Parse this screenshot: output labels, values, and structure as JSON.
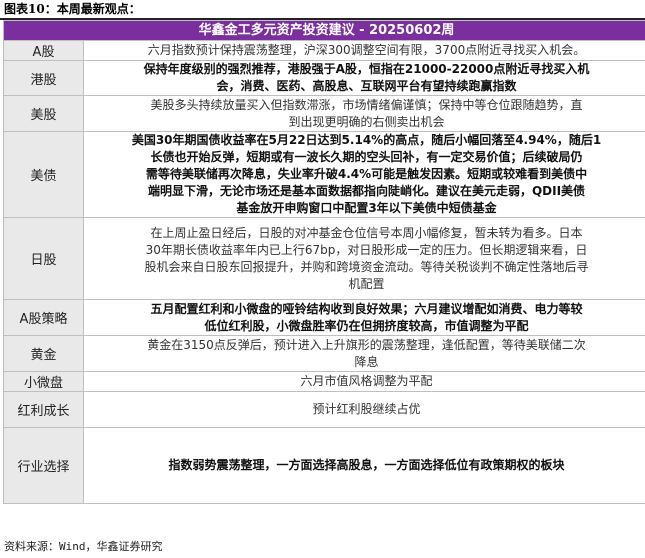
{
  "figure_title": "图表10：本周最新观点：",
  "table_header": "华鑫金工多元资产投资建议 - 20250602周",
  "rows": [
    {
      "label": "A股",
      "style": "normal",
      "lines": [
        "六月指数预计保持震荡整理，沪深300调整空间有限，3700点附近寻找买入机会。"
      ]
    },
    {
      "label": "港股",
      "style": "bold",
      "lines": [
        "保持年度级别的强烈推荐，港股强于A股，恒指在21000-22000点附近寻找买入机",
        "会，消费、医药、高股息、互联网平台有望持续跑赢指数"
      ]
    },
    {
      "label": "美股",
      "style": "normal",
      "lines": [
        "美股多头持续放量买入但指数滞涨，市场情绪偏谨慎；保持中等仓位跟随趋势，直",
        "到出现更明确的右侧卖出机会"
      ]
    },
    {
      "label": "美债",
      "style": "bold",
      "lines": [
        "美国30年期国债收益率在5月22日达到5.14%的高点，随后小幅回落至4.94%，随后1",
        "长债也开始反弹，短期或有一波长久期的空头回补，有一定交易价值；后续破局仍",
        "需等待美联储再次降息，失业率升破4.4%可能是触发因素。短期或较难看到美债中",
        "端明显下滑，无论市场还是基本面数据都指向陡峭化。建议在美元走弱，QDII美债",
        "基金放开申购窗口中配置3年以下美债中短债基金"
      ]
    },
    {
      "label": "日股",
      "style": "normal",
      "lines": [
        "在上周止盈日经后，日股的对冲基金仓位信号本周小幅修复，暂未转为看多。日本",
        "30年期长债收益率年内已上行67bp，对日股形成一定的压力。但长期逻辑来看，日",
        "股机会来自日股东回报提升，并购和跨境资金流动。等待关税谈判不确定性落地后寻",
        "机配置"
      ]
    },
    {
      "label": "A股策略",
      "style": "bold",
      "lines": [
        "五月配置红利和小微盘的哑铃结构收到良好效果；六月建议增配如消费、电力等较",
        "低位红利股，小微盘胜率仍在但拥挤度较高，市值调整为平配"
      ]
    },
    {
      "label": "黄金",
      "style": "normal",
      "lines": [
        "黄金在3150点反弹后，预计进入上升旗形的震荡整理，逢低配置，等待美联储二次",
        "降息"
      ]
    },
    {
      "label": "小微盘",
      "style": "normal",
      "lines": [
        "六月市值风格调整为平配"
      ]
    },
    {
      "label": "红利成长",
      "style": "normal",
      "lines": [
        "预计红利股继续占优"
      ]
    },
    {
      "label": "行业选择",
      "style": "bold",
      "lines": [
        "指数弱势震荡整理，一方面选择高股息，一方面选择低位有政策期权的板块"
      ]
    }
  ],
  "source": "资料来源：Wind，华鑫证券研究",
  "colors": {
    "header_bg": "#7b2f9e",
    "label_bg": "#e9e9e9",
    "border": "#bfbfbf"
  }
}
